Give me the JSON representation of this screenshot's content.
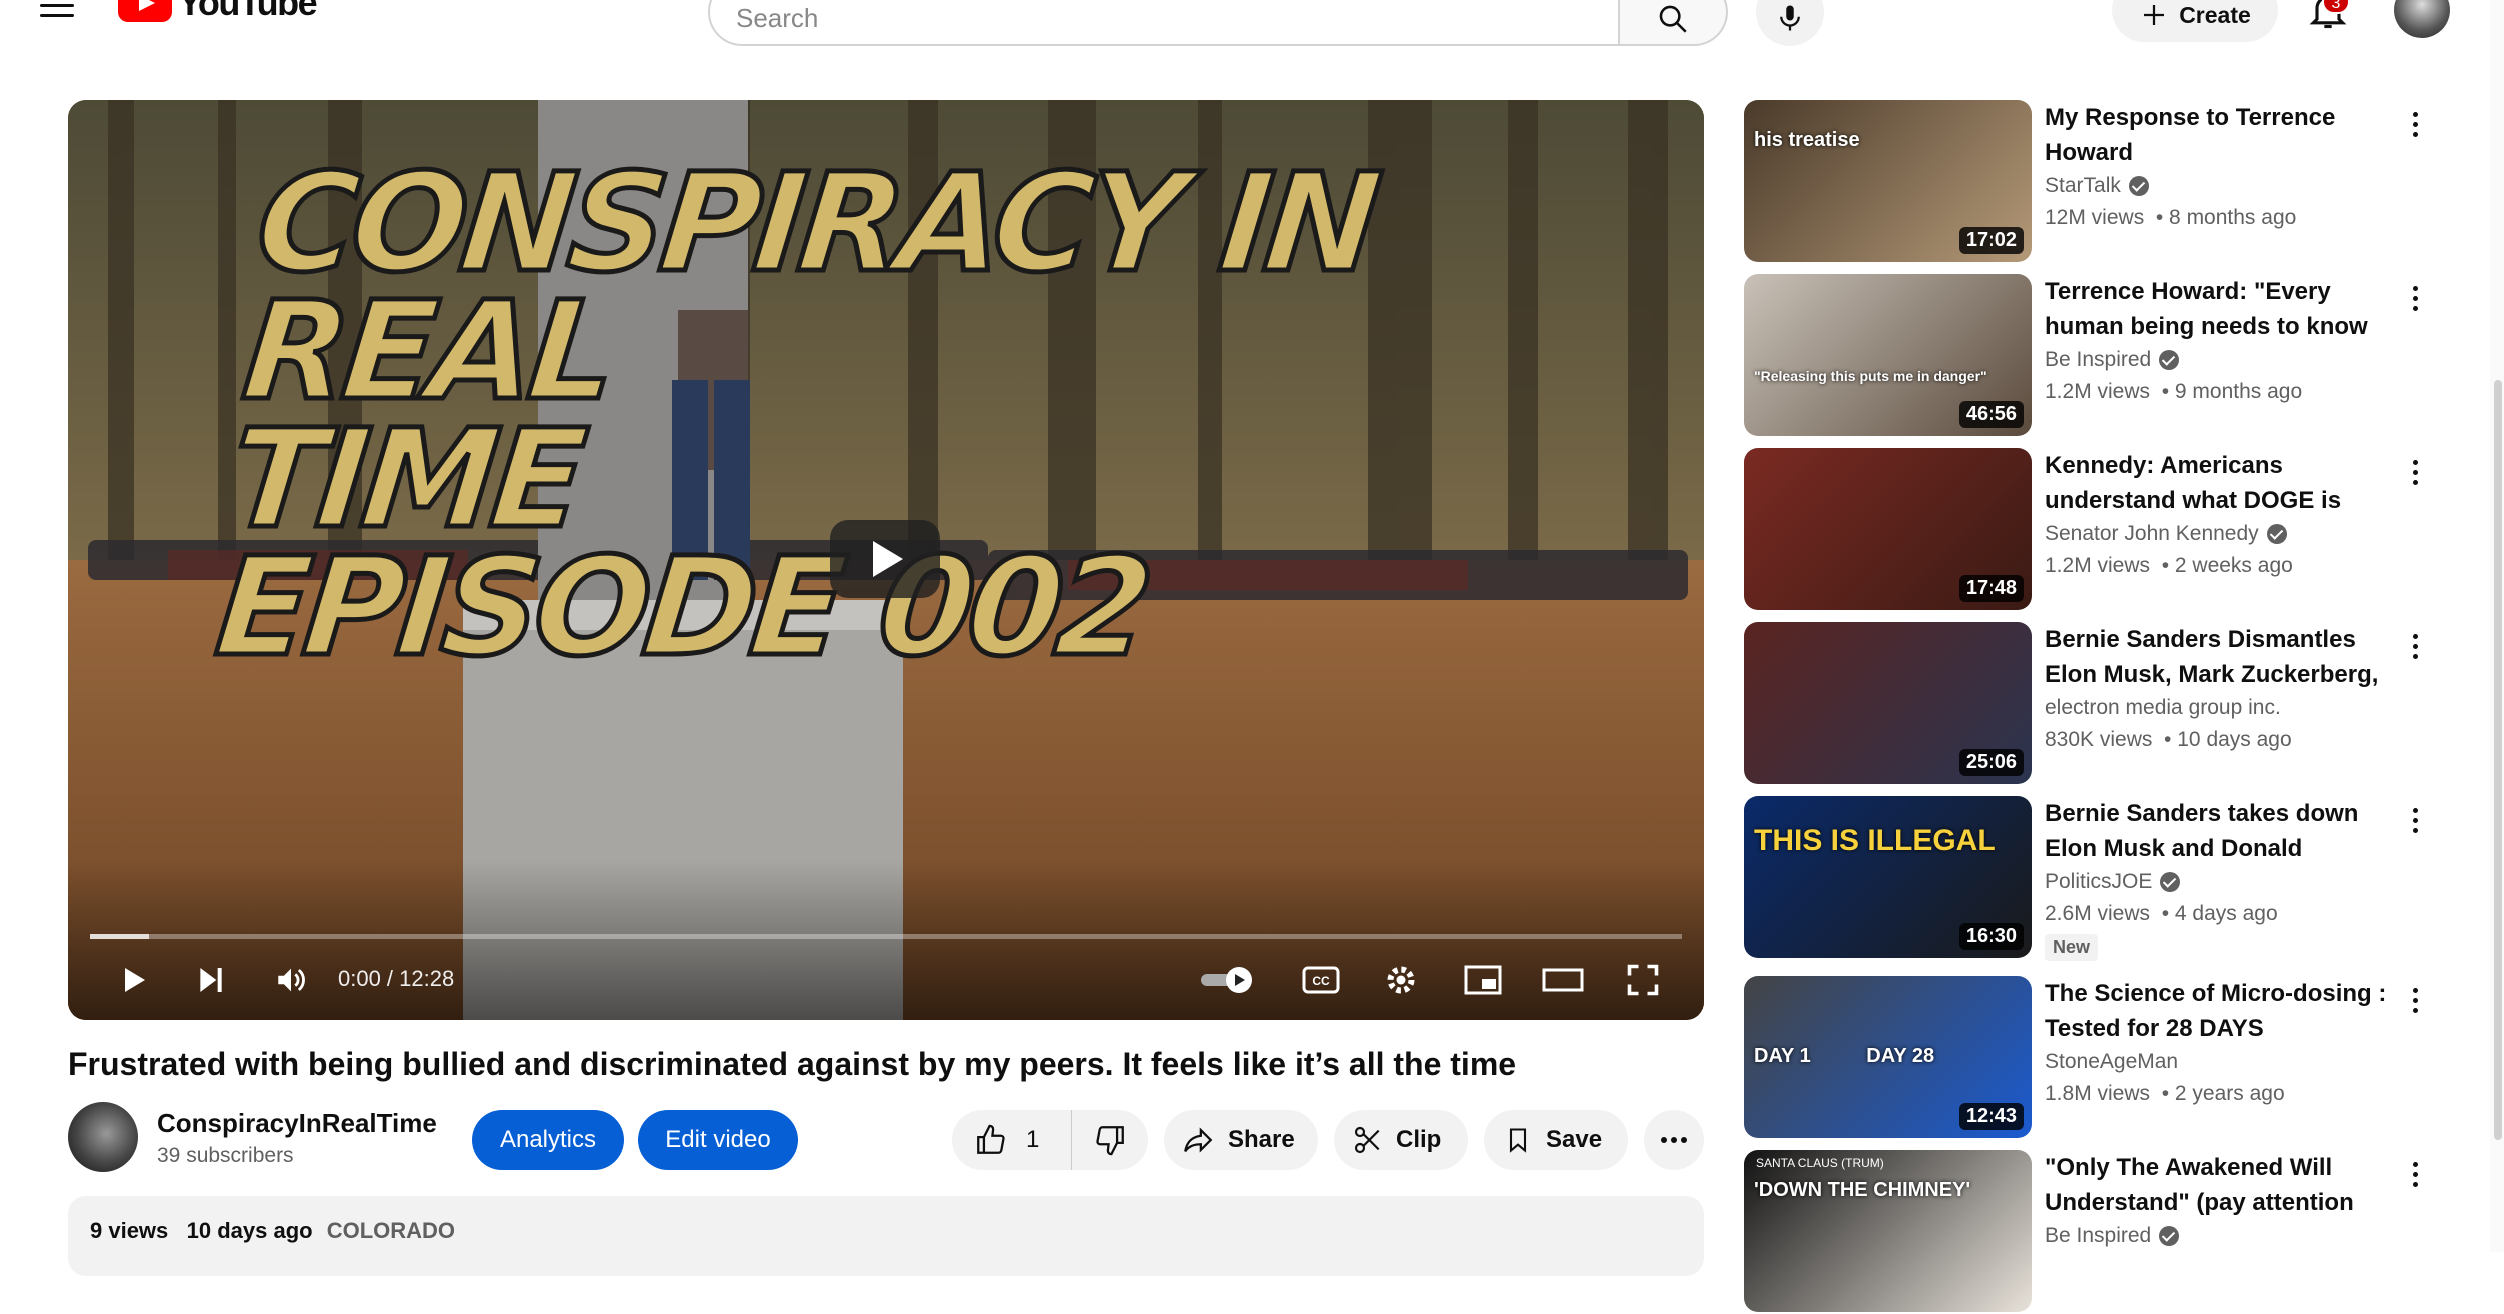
{
  "header": {
    "logo_text": "YouTube",
    "search_placeholder": "Search",
    "create_label": "Create",
    "notification_count": "3"
  },
  "player": {
    "thumbnail_text_line1": "CONSPIRACY IN REAL",
    "thumbnail_text_line2": "TIME",
    "thumbnail_text_line3": "EPISODE 002",
    "time": "0:00 / 12:28",
    "progress_fraction": 0.0
  },
  "video": {
    "title": "Frustrated with being bullied and discriminated against by my peers. It feels like it’s all the time",
    "channel_name": "ConspiracyInRealTime",
    "subscribers": "39 subscribers",
    "analytics_label": "Analytics",
    "edit_label": "Edit video",
    "like_count": "1",
    "share_label": "Share",
    "clip_label": "Clip",
    "save_label": "Save",
    "views": "9 views",
    "age": "10 days ago",
    "location": "COLORADO"
  },
  "recommendations": [
    {
      "title": "My Response to Terrence Howard",
      "channel": "StarTalk",
      "verified": true,
      "meta": "12M views  • 8 months ago",
      "duration": "17:02",
      "thumb_caption": "his treatise",
      "colors": [
        "#4a3a2a",
        "#b59a78"
      ]
    },
    {
      "title": "Terrence Howard: \"Every human being needs to know this\"",
      "channel": "Be Inspired",
      "verified": true,
      "meta": "1.2M views  • 9 months ago",
      "duration": "46:56",
      "thumb_caption": "\"Releasing this puts me in danger\"",
      "colors": [
        "#c9c2b8",
        "#5a4a3c"
      ]
    },
    {
      "title": "Kennedy: Americans understand what DOGE is doing",
      "channel": "Senator John Kennedy",
      "verified": true,
      "meta": "1.2M views  • 2 weeks ago",
      "duration": "17:48",
      "thumb_caption": "",
      "colors": [
        "#7a2a22",
        "#3a1a14"
      ]
    },
    {
      "title": "Bernie Sanders Dismantles Elon Musk, Mark Zuckerberg, Jeff…",
      "channel": "electron media group inc.",
      "verified": false,
      "meta": "830K views  • 10 days ago",
      "duration": "25:06",
      "thumb_caption": "",
      "colors": [
        "#5a2420",
        "#2a3450"
      ]
    },
    {
      "title": "Bernie Sanders takes down Elon Musk and Donald Trump's…",
      "channel": "PoliticsJOE",
      "verified": true,
      "meta": "2.6M views  • 4 days ago",
      "duration": "16:30",
      "thumb_caption": "THIS IS ILLEGAL",
      "badge": "New",
      "colors": [
        "#0a2a6a",
        "#1a1a1a"
      ]
    },
    {
      "title": "The Science of Micro-dosing : Tested for 28 DAYS",
      "channel": "StoneAgeMan",
      "verified": false,
      "meta": "1.8M views  • 2 years ago",
      "duration": "12:43",
      "thumb_caption": "DAY 1          DAY 28",
      "colors": [
        "#444",
        "#1a5ad0"
      ]
    },
    {
      "title": "\"Only The Awakened Will Understand\" (pay attention to…",
      "channel": "Be Inspired",
      "verified": true,
      "meta": "",
      "duration": "",
      "thumb_caption": "'DOWN THE CHIMNEY'",
      "thumb_caption_small": "SANTA CLAUS (TRUM)",
      "colors": [
        "#111",
        "#e8e2da"
      ]
    }
  ]
}
